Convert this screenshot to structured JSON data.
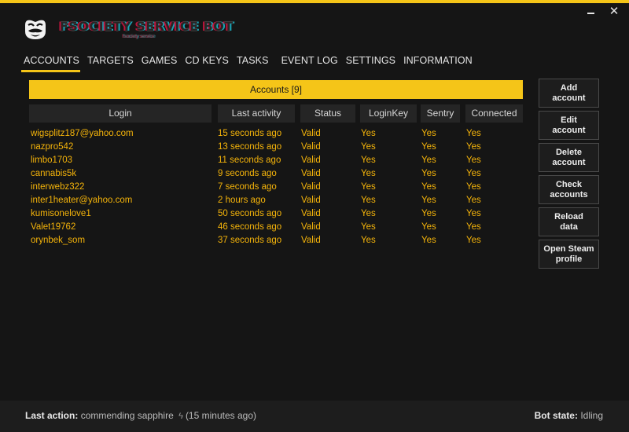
{
  "brand": {
    "title": "FSOCIETY SERVICE BOT",
    "subtitle": "fsociety service"
  },
  "window": {
    "minimize": "—",
    "close": "✕"
  },
  "nav": {
    "tabs": [
      {
        "label": "ACCOUNTS",
        "active": true
      },
      {
        "label": "TARGETS"
      },
      {
        "label": "GAMES"
      },
      {
        "label": "CD KEYS"
      },
      {
        "label": "TASKS"
      },
      {
        "label": "EVENT LOG"
      },
      {
        "label": "SETTINGS"
      },
      {
        "label": "INFORMATION"
      }
    ]
  },
  "accounts": {
    "header": "Accounts [9]",
    "columns": [
      "Login",
      "Last activity",
      "Status",
      "LoginKey",
      "Sentry",
      "Connected"
    ],
    "rows": [
      [
        "wigsplitz187@yahoo.com",
        "15 seconds ago",
        "Valid",
        "Yes",
        "Yes",
        "Yes"
      ],
      [
        "nazpro542",
        "13 seconds ago",
        "Valid",
        "Yes",
        "Yes",
        "Yes"
      ],
      [
        "limbo1703",
        "11 seconds ago",
        "Valid",
        "Yes",
        "Yes",
        "Yes"
      ],
      [
        "cannabis5k",
        "9 seconds ago",
        "Valid",
        "Yes",
        "Yes",
        "Yes"
      ],
      [
        "interwebz322",
        "7 seconds ago",
        "Valid",
        "Yes",
        "Yes",
        "Yes"
      ],
      [
        "inter1heater@yahoo.com",
        "2 hours ago",
        "Valid",
        "Yes",
        "Yes",
        "Yes"
      ],
      [
        "kumisonelove1",
        "50 seconds ago",
        "Valid",
        "Yes",
        "Yes",
        "Yes"
      ],
      [
        "Valet19762",
        "46 seconds ago",
        "Valid",
        "Yes",
        "Yes",
        "Yes"
      ],
      [
        "orynbek_som",
        "37 seconds ago",
        "Valid",
        "Yes",
        "Yes",
        "Yes"
      ]
    ]
  },
  "actions": [
    {
      "label": "Add account"
    },
    {
      "label": "Edit account"
    },
    {
      "label": "Delete account"
    },
    {
      "label": "Check accounts"
    },
    {
      "label": "Reload data"
    },
    {
      "label": "Open Steam profile"
    }
  ],
  "footer": {
    "last_action_label": "Last action:",
    "last_action_value": "commending sapphire",
    "last_action_icon": "lightning-bolt-icon",
    "last_action_time": "(15 minutes ago)",
    "bot_state_label": "Bot state:",
    "bot_state_value": "Idling"
  },
  "colors": {
    "accent": "#f5c518",
    "row_text": "#f5b40a",
    "background": "#151515"
  }
}
